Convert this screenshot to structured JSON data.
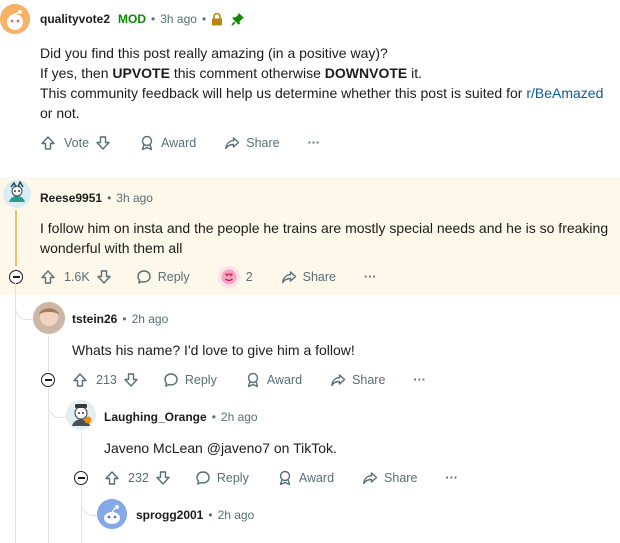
{
  "comments": [
    {
      "user": "qualityvote2",
      "badge": "MOD",
      "time": "3h ago",
      "lines": {
        "l1": "Did you find this post really amazing (in a positive way)?",
        "l2_a": "If yes, then ",
        "l2_b": "UPVOTE",
        "l2_c": " this comment otherwise ",
        "l2_d": "DOWNVOTE",
        "l2_e": " it.",
        "l3_a": "This community feedback will help us determine whether this post is suited for ",
        "l3_link": "r/BeAmazed",
        "l4": "or not."
      },
      "vote_label": "Vote",
      "award_label": "Award",
      "share_label": "Share",
      "more": "···"
    },
    {
      "user": "Reese9951",
      "time": "3h ago",
      "text_l1": "I follow him on insta and the people he trains are mostly special needs and he is so freaking",
      "text_l2": "wonderful with them all",
      "votes": "1.6K",
      "reply_label": "Reply",
      "award_count": "2",
      "share_label": "Share",
      "more": "···"
    },
    {
      "user": "tstein26",
      "time": "2h ago",
      "text": "Whats his name? I'd love to give him a follow!",
      "votes": "213",
      "reply_label": "Reply",
      "award_label": "Award",
      "share_label": "Share",
      "more": "···"
    },
    {
      "user": "Laughing_Orange",
      "time": "2h ago",
      "text": "Javeno McLean @javeno7 on TikTok.",
      "votes": "232",
      "reply_label": "Reply",
      "award_label": "Award",
      "share_label": "Share",
      "more": "···"
    },
    {
      "user": "sprogg2001",
      "time": "2h ago"
    }
  ],
  "colors": {
    "mod_green": "#0e8a00",
    "link_blue": "#0a5a9c",
    "highlight_bg": "#fdf8e9",
    "highlight_line": "#e9c46a",
    "meta_gray": "#576f76"
  }
}
